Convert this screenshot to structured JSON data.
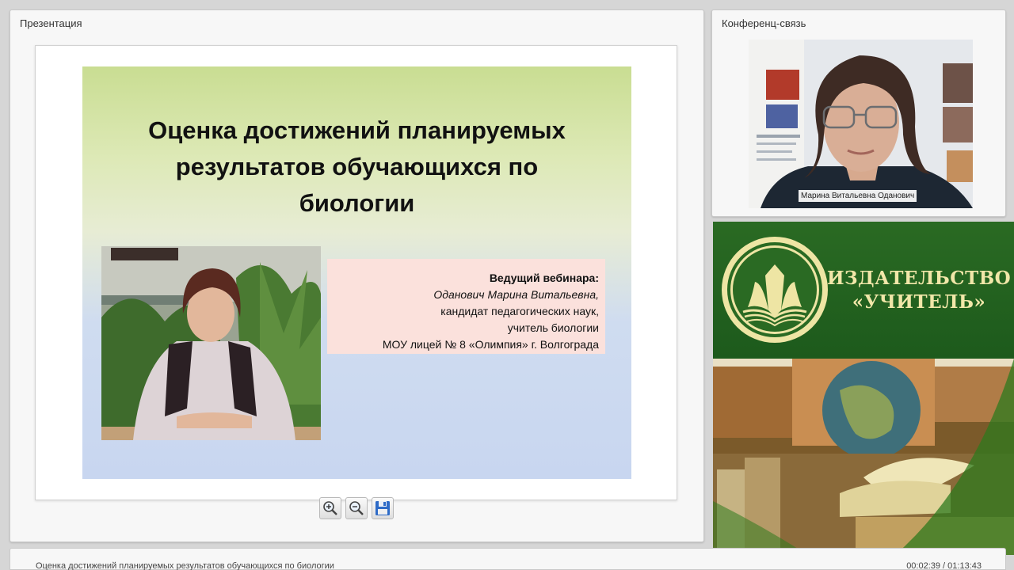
{
  "presentation": {
    "panel_title": "Презентация",
    "slide": {
      "title_lines": [
        "Оценка достижений планируемых",
        "результатов обучающихся по",
        "биологии"
      ],
      "host_heading": "Ведущий вебинара:",
      "host_name": "Оданович Марина Витальевна,",
      "host_degree": "кандидат педагогических наук,",
      "host_position": "учитель биологии",
      "host_school": "МОУ лицей № 8 «Олимпия» г. Волгограда"
    },
    "toolbar": {
      "zoom_in_icon": "zoom-in-icon",
      "zoom_out_icon": "zoom-out-icon",
      "save_icon": "save-icon"
    }
  },
  "video": {
    "panel_title": "Конференц-связь",
    "participant_name": "Марина Витальевна Оданович"
  },
  "banner": {
    "publisher_line1": "ИЗДАТЕЛЬСТВО",
    "publisher_line2": "«УЧИТЕЛЬ»",
    "logo_icon": "open-book-logo-icon"
  },
  "status": {
    "webinar_title": "Оценка достижений планируемых результатов обучающихся по биологии",
    "time": "00:02:39 / 01:13:43"
  },
  "colors": {
    "banner_green": "#1e5c1f",
    "banner_text": "#f1e7a9",
    "info_box": "#fbe1dc"
  }
}
